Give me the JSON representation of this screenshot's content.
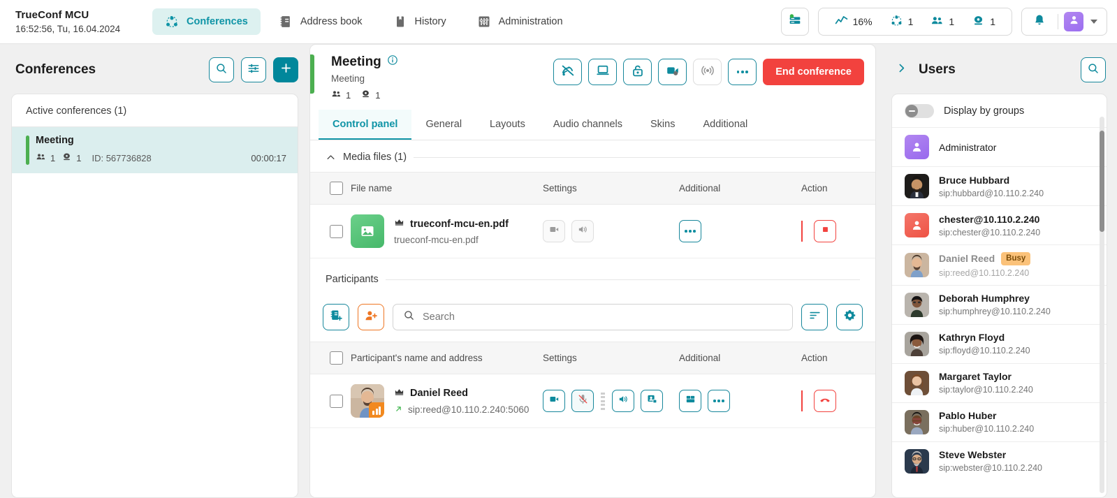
{
  "app": {
    "title": "TrueConf MCU",
    "datetime": "16:52:56, Tu, 16.04.2024"
  },
  "nav": [
    {
      "label": "Conferences",
      "icon": "conferences-icon",
      "active": true
    },
    {
      "label": "Address book",
      "icon": "address-book-icon",
      "active": false
    },
    {
      "label": "History",
      "icon": "history-icon",
      "active": false
    },
    {
      "label": "Administration",
      "icon": "administration-icon",
      "active": false
    }
  ],
  "topright": {
    "server_icon": "server-status-icon",
    "stats": [
      {
        "icon": "cpu-graph-icon",
        "value": "16%"
      },
      {
        "icon": "conferences-icon",
        "value": "1"
      },
      {
        "icon": "participants-icon",
        "value": "1"
      },
      {
        "icon": "endpoint-icon",
        "value": "1"
      }
    ],
    "bell_icon": "bell-icon",
    "avatar_icon": "user-avatar-icon",
    "caret_icon": "chevron-down-icon"
  },
  "left": {
    "title": "Conferences",
    "buttons": [
      {
        "name": "search-button",
        "icon": "search-icon"
      },
      {
        "name": "filter-button",
        "icon": "sliders-icon"
      },
      {
        "name": "add-conference-button",
        "icon": "plus-icon"
      }
    ],
    "section_label": "Active conferences (1)",
    "conference": {
      "name": "Meeting",
      "participants": "1",
      "endpoints": "1",
      "id_label": "ID: 567736828",
      "duration": "00:00:17",
      "status_color": "#4caf50"
    }
  },
  "meeting": {
    "title": "Meeting",
    "info_icon": "info-icon",
    "subtitle": "Meeting",
    "participants": "1",
    "endpoints": "1",
    "actions": [
      {
        "name": "mute-all-button",
        "icon": "mic-off-broadcast-icon",
        "enabled": true
      },
      {
        "name": "presentation-button",
        "icon": "laptop-icon",
        "enabled": true
      },
      {
        "name": "lock-conference-button",
        "icon": "unlock-icon",
        "enabled": true
      },
      {
        "name": "record-video-button",
        "icon": "video-record-icon",
        "enabled": true
      },
      {
        "name": "streaming-button",
        "icon": "broadcast-icon",
        "enabled": false
      },
      {
        "name": "more-options-button",
        "icon": "ellipsis-icon",
        "enabled": true
      }
    ],
    "end_label": "End conference"
  },
  "tabs": [
    {
      "label": "Control panel",
      "active": true
    },
    {
      "label": "General",
      "active": false
    },
    {
      "label": "Layouts",
      "active": false
    },
    {
      "label": "Audio channels",
      "active": false
    },
    {
      "label": "Skins",
      "active": false
    },
    {
      "label": "Additional",
      "active": false
    }
  ],
  "media": {
    "group_label": "Media files (1)",
    "collapse_icon": "chevron-up-icon",
    "columns": {
      "name": "File name",
      "settings": "Settings",
      "additional": "Additional",
      "action": "Action"
    },
    "rows": [
      {
        "thumb_icon": "image-file-icon",
        "owner_icon": "crown-icon",
        "name": "trueconf-mcu-en.pdf",
        "subname": "trueconf-mcu-en.pdf",
        "settings": [
          {
            "name": "file-video-button",
            "icon": "video-file-icon",
            "enabled": false
          },
          {
            "name": "file-audio-button",
            "icon": "speaker-icon",
            "enabled": false
          }
        ],
        "additional": [
          {
            "name": "file-more-button",
            "icon": "ellipsis-icon",
            "enabled": true
          }
        ],
        "action": {
          "name": "stop-file-button",
          "icon": "stop-square-icon"
        }
      }
    ]
  },
  "participants": {
    "group_label": "Participants",
    "toolbar": {
      "invite_from_address_book": {
        "name": "invite-from-address-book-button",
        "icon": "address-book-add-icon"
      },
      "invite_user": {
        "name": "invite-user-button",
        "icon": "user-add-icon"
      },
      "search_placeholder": "Search",
      "search_value": "",
      "search_icon": "search-icon",
      "sort_button": {
        "name": "sort-button",
        "icon": "sort-icon"
      },
      "settings_button": {
        "name": "participants-settings-button",
        "icon": "gear-icon"
      }
    },
    "columns": {
      "name": "Participant's name and address",
      "settings": "Settings",
      "additional": "Additional",
      "action": "Action"
    },
    "rows": [
      {
        "owner_icon": "crown-icon",
        "name": "Daniel Reed",
        "direction_icon": "outgoing-arrow-icon",
        "address": "sip:reed@10.110.2.240:5060",
        "avatar": "participant-photo",
        "level_badge": "signal-level-icon",
        "settings": [
          {
            "name": "toggle-video-button",
            "icon": "video-icon",
            "state": "on"
          },
          {
            "name": "toggle-mic-button",
            "icon": "mic-off-icon",
            "state": "off"
          },
          {
            "name": "volume-button",
            "icon": "speaker-icon",
            "state": "on"
          },
          {
            "name": "podium-button",
            "icon": "podium-icon",
            "state": "on"
          }
        ],
        "additional": [
          {
            "name": "layout-button",
            "icon": "layout-icon"
          },
          {
            "name": "participant-more-button",
            "icon": "ellipsis-icon"
          }
        ],
        "action": {
          "name": "hangup-button",
          "icon": "hangup-icon"
        }
      }
    ]
  },
  "users": {
    "collapse_icon": "chevron-right-icon",
    "title": "Users",
    "search_button": {
      "name": "users-search-button",
      "icon": "search-icon"
    },
    "display_by_groups": {
      "label": "Display by groups",
      "on": false
    },
    "list": [
      {
        "name": "Administrator",
        "sip": "",
        "avatar": "purple-avatar",
        "status": ""
      },
      {
        "name": "Bruce Hubbard",
        "sip": "sip:hubbard@10.110.2.240",
        "avatar": "photo-1",
        "status": ""
      },
      {
        "name": "chester@10.110.2.240",
        "sip": "sip:chester@10.110.2.240",
        "avatar": "red-avatar",
        "status": ""
      },
      {
        "name": "Daniel Reed",
        "sip": "sip:reed@10.110.2.240",
        "avatar": "photo-2",
        "status": "Busy"
      },
      {
        "name": "Deborah Humphrey",
        "sip": "sip:humphrey@10.110.2.240",
        "avatar": "photo-3",
        "status": ""
      },
      {
        "name": "Kathryn Floyd",
        "sip": "sip:floyd@10.110.2.240",
        "avatar": "photo-4",
        "status": ""
      },
      {
        "name": "Margaret Taylor",
        "sip": "sip:taylor@10.110.2.240",
        "avatar": "photo-5",
        "status": ""
      },
      {
        "name": "Pablo Huber",
        "sip": "sip:huber@10.110.2.240",
        "avatar": "photo-6",
        "status": ""
      },
      {
        "name": "Steve Webster",
        "sip": "sip:webster@10.110.2.240",
        "avatar": "photo-7",
        "status": ""
      }
    ]
  },
  "colors": {
    "accent": "#00879b",
    "accent_text": "#0f94a6",
    "danger": "#f2423e",
    "success": "#4caf50",
    "orange": "#ee7623",
    "busy_badge": "#fbc27a"
  }
}
